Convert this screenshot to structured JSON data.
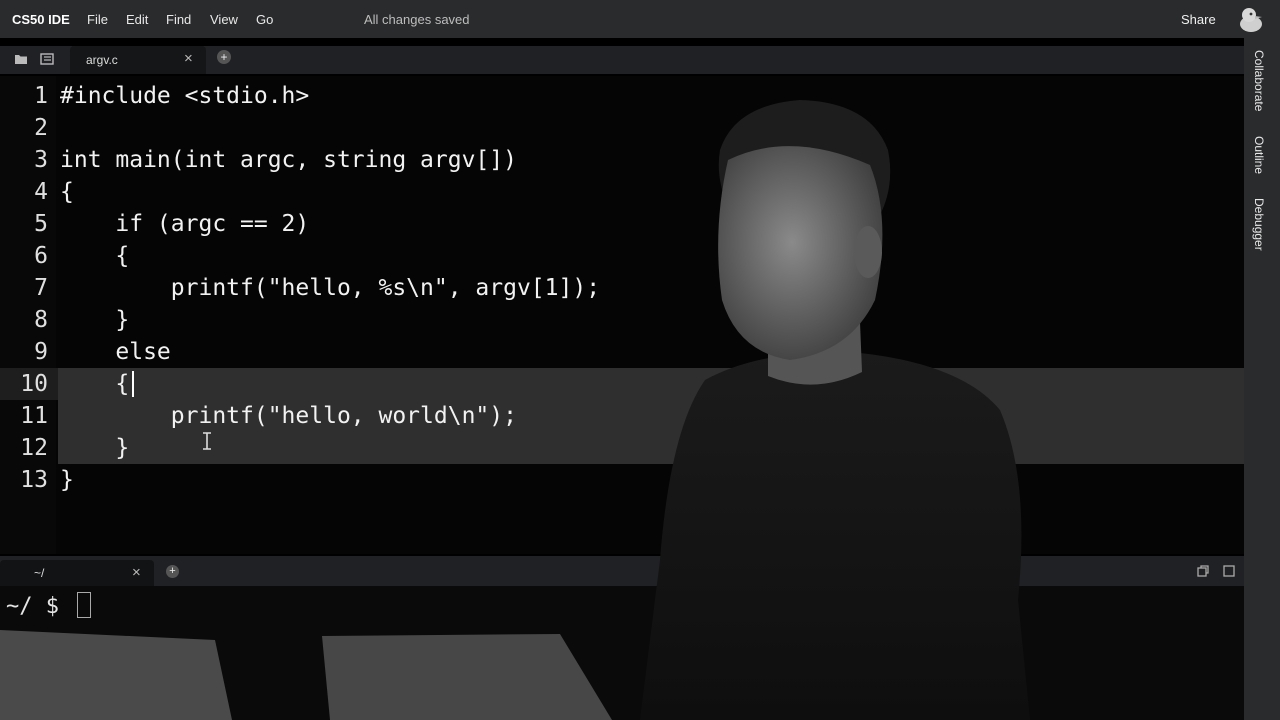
{
  "menubar": {
    "brand": "CS50 IDE",
    "items": [
      "File",
      "Edit",
      "Find",
      "View",
      "Go"
    ],
    "status": "All changes saved",
    "share_label": "Share"
  },
  "tabs": {
    "file_tab_label": "argv.c",
    "close_glyph": "×",
    "add_glyph": "+"
  },
  "right_rail": {
    "items": [
      "Collaborate",
      "Outline",
      "Debugger"
    ]
  },
  "editor": {
    "active_line": 10,
    "selected_lines": [
      10,
      11,
      12
    ],
    "lines": [
      {
        "num": "1",
        "text": "#include <stdio.h>"
      },
      {
        "num": "2",
        "text": ""
      },
      {
        "num": "3",
        "text": "int main(int argc, string argv[])"
      },
      {
        "num": "4",
        "text": "{"
      },
      {
        "num": "5",
        "text": "    if (argc == 2)"
      },
      {
        "num": "6",
        "text": "    {"
      },
      {
        "num": "7",
        "text": "        printf(\"hello, %s\\n\", argv[1]);"
      },
      {
        "num": "8",
        "text": "    }"
      },
      {
        "num": "9",
        "text": "    else"
      },
      {
        "num": "10",
        "text": "    {"
      },
      {
        "num": "11",
        "text": "        printf(\"hello, world\\n\");"
      },
      {
        "num": "12",
        "text": "    }"
      },
      {
        "num": "13",
        "text": "}"
      }
    ]
  },
  "terminal": {
    "tab_label": "~/",
    "close_glyph": "×",
    "add_glyph": "+",
    "prompt": "~/ $"
  },
  "colors": {
    "menubar_bg": "#2a2b2d",
    "editor_bg": "#050505",
    "selection_bg": "#2f2f2f",
    "text": "#f2f2f2"
  },
  "icons": {
    "tab_bar": [
      "folder-icon",
      "outline-toggle-icon"
    ],
    "avatar": "duck-avatar-icon",
    "terminal": [
      "restore-icon",
      "maximize-icon"
    ]
  }
}
